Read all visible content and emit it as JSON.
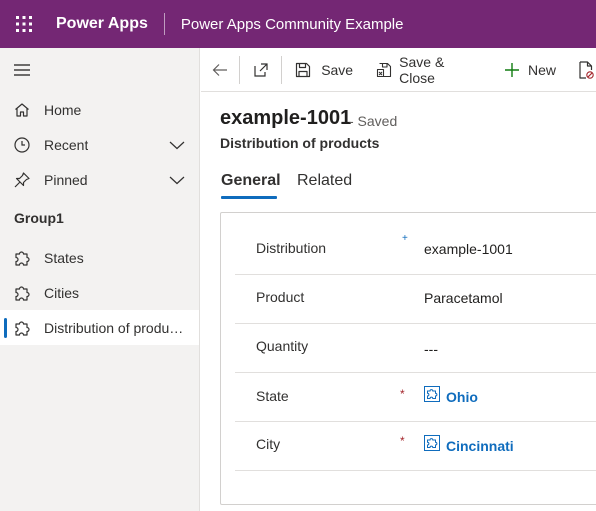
{
  "header": {
    "app_name": "Power Apps",
    "subtitle": "Power Apps Community Example"
  },
  "sidebar": {
    "items": [
      {
        "label": "Home",
        "icon": "home-icon"
      },
      {
        "label": "Recent",
        "icon": "clock-icon"
      },
      {
        "label": "Pinned",
        "icon": "pin-icon"
      }
    ],
    "group_label": "Group1",
    "group_items": [
      {
        "label": "States",
        "icon": "puzzle-icon"
      },
      {
        "label": "Cities",
        "icon": "puzzle-icon"
      },
      {
        "label": "Distribution of products",
        "icon": "puzzle-icon",
        "selected": true
      }
    ]
  },
  "commandbar": {
    "save_label": "Save",
    "save_close_label": "Save & Close",
    "new_label": "New"
  },
  "form": {
    "title": "example-1001",
    "status": "- Saved",
    "entity": "Distribution of products",
    "tabs": [
      "General",
      "Related"
    ],
    "active_tab": "General",
    "fields": [
      {
        "label": "Distribution",
        "value": "example-1001",
        "marker": "+"
      },
      {
        "label": "Product",
        "value": "Paracetamol"
      },
      {
        "label": "Quantity",
        "value": "---"
      },
      {
        "label": "State",
        "value": "Ohio",
        "required_marker": "*"
      },
      {
        "label": "City",
        "value": "Cincinnati",
        "required_marker": "*"
      }
    ]
  },
  "colors": {
    "header_bg": "#742774",
    "accent": "#0f6cbd",
    "required": "#a4262c",
    "sidebar_bg": "#f3f2f1"
  }
}
